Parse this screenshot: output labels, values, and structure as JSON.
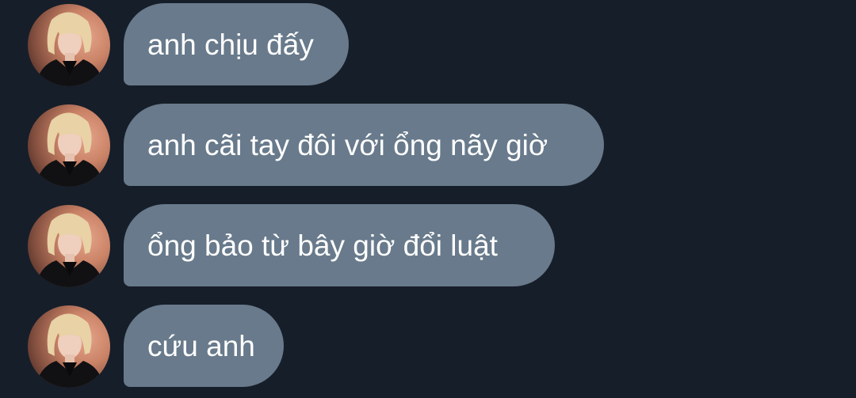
{
  "messages": [
    {
      "text": "anh chịu đấy"
    },
    {
      "text": "anh cãi tay đôi với ổng nãy giờ"
    },
    {
      "text": "ổng bảo từ bây giờ đổi luật"
    },
    {
      "text": "cứu anh"
    }
  ],
  "colors": {
    "background": "#161e29",
    "bubble": "#687a8b",
    "text": "#ffffff"
  }
}
